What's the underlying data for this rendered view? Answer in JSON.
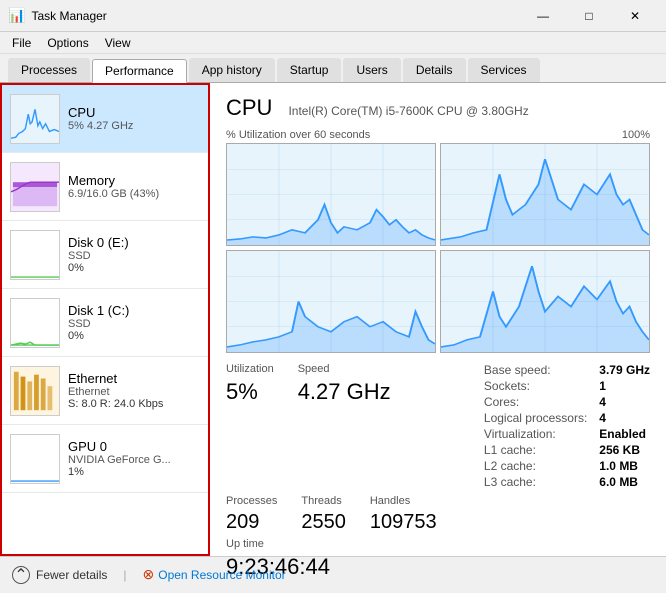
{
  "titleBar": {
    "icon": "📊",
    "title": "Task Manager",
    "minimizeLabel": "—",
    "maximizeLabel": "□",
    "closeLabel": "✕"
  },
  "menuBar": {
    "items": [
      "File",
      "Options",
      "View"
    ]
  },
  "tabs": [
    {
      "label": "Processes",
      "active": false
    },
    {
      "label": "Performance",
      "active": true
    },
    {
      "label": "App history",
      "active": false
    },
    {
      "label": "Startup",
      "active": false
    },
    {
      "label": "Users",
      "active": false
    },
    {
      "label": "Details",
      "active": false
    },
    {
      "label": "Services",
      "active": false
    }
  ],
  "leftPanel": {
    "resources": [
      {
        "id": "cpu",
        "name": "CPU",
        "detail1": "5% 4.27 GHz",
        "detail2": "",
        "selected": true,
        "color": "#3399ff"
      },
      {
        "id": "memory",
        "name": "Memory",
        "detail1": "6.9/16.0 GB (43%)",
        "detail2": "",
        "selected": false,
        "color": "#9933cc"
      },
      {
        "id": "disk0",
        "name": "Disk 0 (E:)",
        "detail1": "SSD",
        "detail2": "0%",
        "selected": false,
        "color": "#55cc55"
      },
      {
        "id": "disk1",
        "name": "Disk 1 (C:)",
        "detail1": "SSD",
        "detail2": "0%",
        "selected": false,
        "color": "#55cc55"
      },
      {
        "id": "ethernet",
        "name": "Ethernet",
        "detail1": "Ethernet",
        "detail2": "S: 8.0  R: 24.0 Kbps",
        "selected": false,
        "color": "#cc8800"
      },
      {
        "id": "gpu0",
        "name": "GPU 0",
        "detail1": "NVIDIA GeForce G...",
        "detail2": "1%",
        "selected": false,
        "color": "#3399ff"
      }
    ]
  },
  "rightPanel": {
    "title": "CPU",
    "subtitle": "Intel(R) Core(TM) i5-7600K CPU @ 3.80GHz",
    "chartLabel": "% Utilization over 60 seconds",
    "chartMax": "100%",
    "stats": {
      "utilization": {
        "label": "Utilization",
        "value": "5%"
      },
      "speed": {
        "label": "Speed",
        "value": "4.27 GHz"
      },
      "processes": {
        "label": "Processes",
        "value": "209"
      },
      "threads": {
        "label": "Threads",
        "value": "2550"
      },
      "handles": {
        "label": "Handles",
        "value": "109753"
      },
      "uptime": {
        "label": "Up time",
        "value": "9:23:46:44"
      }
    },
    "sideStats": [
      {
        "label": "Base speed:",
        "value": "3.79 GHz"
      },
      {
        "label": "Sockets:",
        "value": "1"
      },
      {
        "label": "Cores:",
        "value": "4"
      },
      {
        "label": "Logical processors:",
        "value": "4"
      },
      {
        "label": "Virtualization:",
        "value": "Enabled"
      },
      {
        "label": "L1 cache:",
        "value": "256 KB"
      },
      {
        "label": "L2 cache:",
        "value": "1.0 MB"
      },
      {
        "label": "L3 cache:",
        "value": "6.0 MB"
      }
    ]
  },
  "footer": {
    "fewerDetails": "Fewer details",
    "separator": "|",
    "openResourceMonitor": "Open Resource Monitor"
  }
}
